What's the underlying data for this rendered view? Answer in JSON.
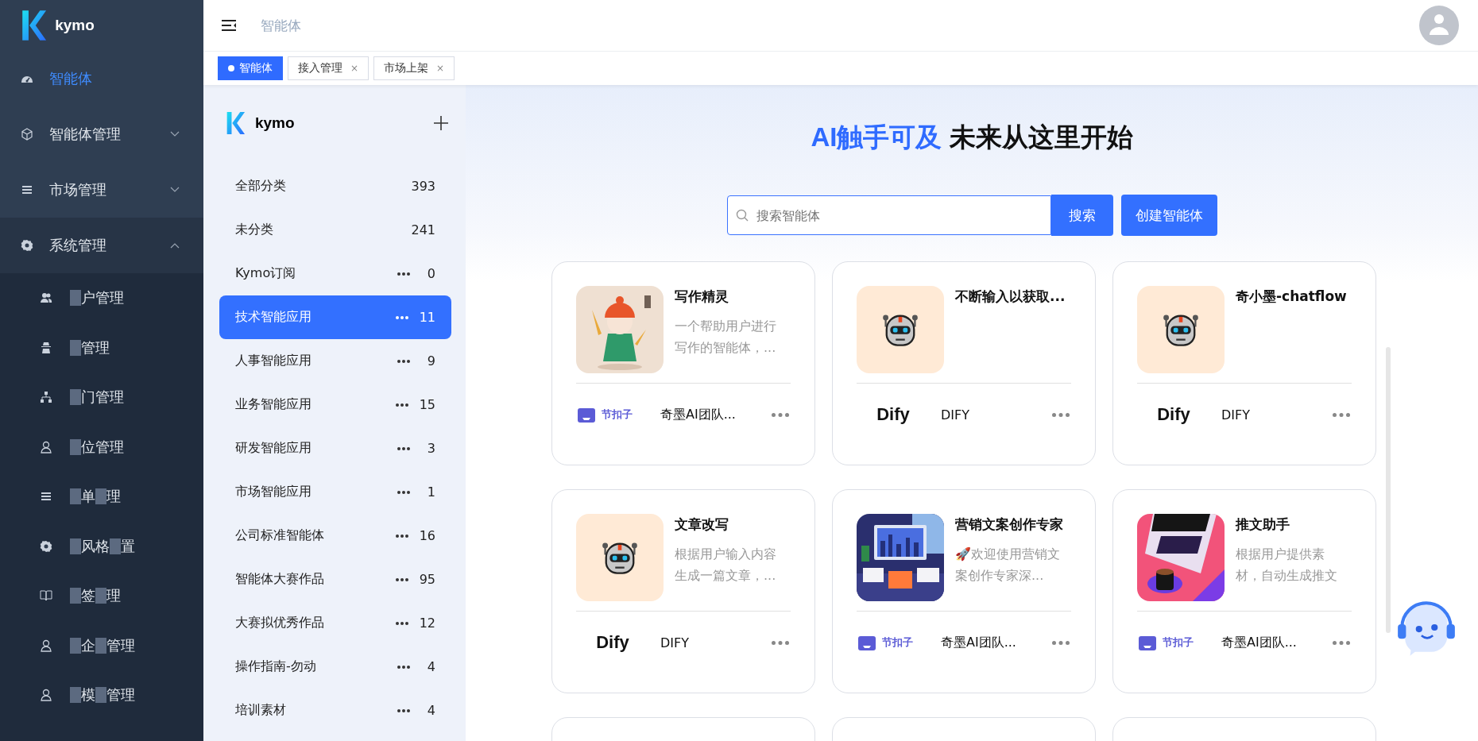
{
  "brand": {
    "name": "kymo"
  },
  "nav": [
    {
      "label": "智能体",
      "selected": true
    },
    {
      "label": "智能体管理",
      "selected": false,
      "expanded": false
    },
    {
      "label": "市场管理",
      "selected": false,
      "expanded": false
    },
    {
      "label": "系统管理",
      "selected": false,
      "expanded": true,
      "children": [
        {
          "parts": [
            "户管理"
          ]
        },
        {
          "parts": [
            "管理"
          ]
        },
        {
          "parts": [
            "门管理"
          ]
        },
        {
          "parts": [
            "位管理"
          ]
        },
        {
          "parts": [
            "单",
            "理"
          ]
        },
        {
          "parts": [
            "风格",
            "置"
          ]
        },
        {
          "parts": [
            "签",
            "理"
          ]
        },
        {
          "parts": [
            "企",
            "管理"
          ]
        },
        {
          "parts": [
            "模",
            "管理"
          ]
        }
      ]
    }
  ],
  "header": {
    "breadcrumb": "智能体"
  },
  "tabs": [
    {
      "label": "智能体",
      "selected": true,
      "closable": false
    },
    {
      "label": "接入管理",
      "selected": false,
      "closable": true
    },
    {
      "label": "市场上架",
      "selected": false,
      "closable": true
    }
  ],
  "close_mark": "×",
  "categories_panel": {
    "brand": "kymo",
    "items": [
      {
        "label": "全部分类",
        "count": "393",
        "has_menu": false,
        "selected": false
      },
      {
        "label": "未分类",
        "count": "241",
        "has_menu": false,
        "selected": false
      },
      {
        "label": "Kymo订阅",
        "count": "0",
        "has_menu": true,
        "selected": false
      },
      {
        "label": "技术智能应用",
        "count": "11",
        "has_menu": true,
        "selected": true
      },
      {
        "label": "人事智能应用",
        "count": "9",
        "has_menu": true,
        "selected": false
      },
      {
        "label": "业务智能应用",
        "count": "15",
        "has_menu": true,
        "selected": false
      },
      {
        "label": "研发智能应用",
        "count": "3",
        "has_menu": true,
        "selected": false
      },
      {
        "label": "市场智能应用",
        "count": "1",
        "has_menu": true,
        "selected": false
      },
      {
        "label": "公司标准智能体",
        "count": "16",
        "has_menu": true,
        "selected": false
      },
      {
        "label": "智能体大赛作品",
        "count": "95",
        "has_menu": true,
        "selected": false
      },
      {
        "label": "大赛拟优秀作品",
        "count": "12",
        "has_menu": true,
        "selected": false
      },
      {
        "label": "操作指南-勿动",
        "count": "4",
        "has_menu": true,
        "selected": false
      },
      {
        "label": "培训素材",
        "count": "4",
        "has_menu": true,
        "selected": false
      }
    ]
  },
  "hero": {
    "title_accent": "AI触手可及",
    "title_rest": "未来从这里开始"
  },
  "search": {
    "placeholder": "搜索智能体",
    "button": "搜索",
    "create_button": "创建智能体"
  },
  "cards": [
    {
      "kind": "agent",
      "name": "写作精灵",
      "desc": "一个帮助用户进行写作的智能体，...",
      "provider": {
        "kind": "coze",
        "logo": "节扣子",
        "name": "奇墨AI团队..."
      }
    },
    {
      "kind": "agent",
      "thumbnail": {
        "kind": "robot"
      },
      "name": "不断输入以获取...",
      "provider": {
        "kind": "dify",
        "logo": "Dify",
        "name": "DIFY"
      }
    },
    {
      "kind": "agent",
      "thumbnail": {
        "kind": "robot"
      },
      "name": "奇小墨-chatflow",
      "provider": {
        "kind": "dify",
        "logo": "Dify",
        "name": "DIFY"
      }
    },
    {
      "kind": "agent",
      "thumbnail": {
        "kind": "robot"
      },
      "name": "文章改写",
      "desc": "根据用户输入内容生成一篇文章，...",
      "provider": {
        "kind": "dify",
        "logo": "Dify",
        "name": "DIFY"
      }
    },
    {
      "kind": "agent",
      "name": "营销文案创作专家",
      "desc": "🚀欢迎使用营销文案创作专家深...",
      "provider": {
        "kind": "coze",
        "logo": "节扣子",
        "name": "奇墨AI团队..."
      }
    },
    {
      "kind": "agent",
      "name": "推文助手",
      "desc": "根据用户提供素材，自动生成推文",
      "provider": {
        "kind": "coze",
        "logo": "节扣子",
        "name": "奇墨AI团队..."
      }
    },
    {
      "kind": "partial"
    },
    {
      "kind": "partial"
    },
    {
      "kind": "partial"
    }
  ]
}
